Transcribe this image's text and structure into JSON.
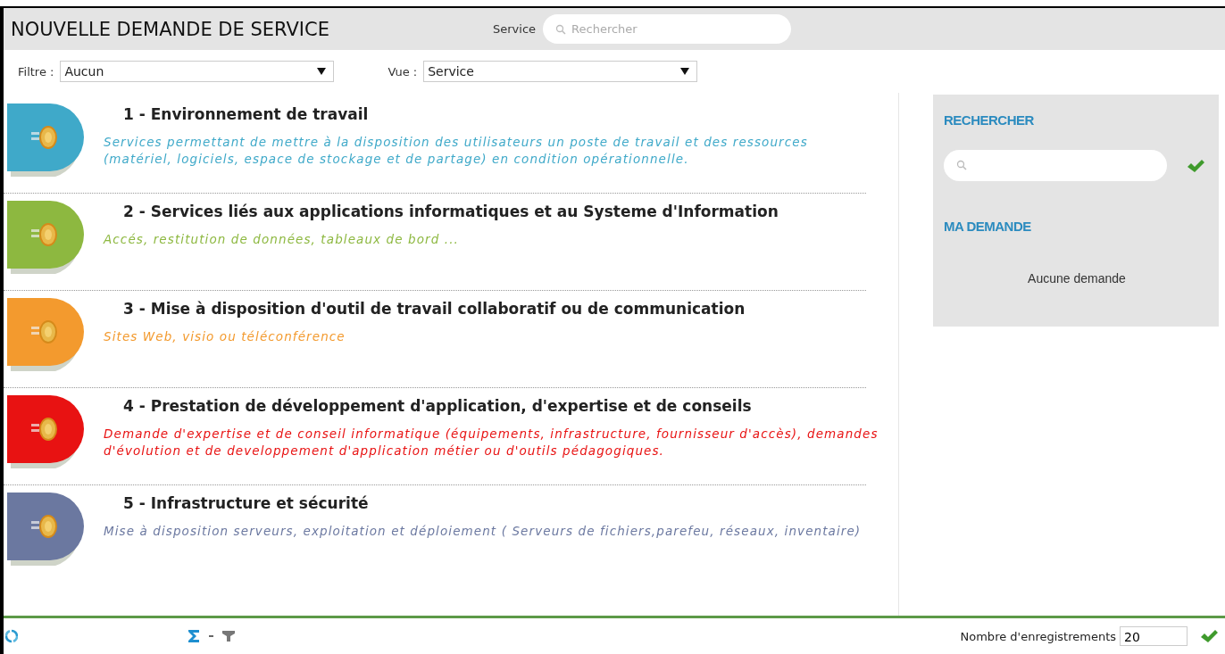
{
  "header": {
    "title": "NOUVELLE DEMANDE DE SERVICE",
    "search_label": "Service",
    "search": {
      "placeholder": "Rechercher"
    }
  },
  "filters": [
    {
      "label": "Filtre :",
      "value": "Aucun"
    },
    {
      "label": "Vue :",
      "value": "Service"
    }
  ],
  "services": [
    {
      "title": "1 - Environnement de travail",
      "description": "Services permettant de mettre à la disposition des utilisateurs un poste de travail et des ressources (matériel, logiciels, espace de stockage et de partage) en condition opérationnelle.",
      "color": "#3fa9c9"
    },
    {
      "title": "2 - Services liés aux applications informatiques et au Systeme d'Information",
      "description": "Accés, restitution de données, tableaux de bord ...",
      "color": "#8db840"
    },
    {
      "title": "3 - Mise à disposition d'outil de travail collaboratif ou de communication",
      "description": "Sites Web, visio ou téléconférence",
      "color": "#f39a2e"
    },
    {
      "title": "4 - Prestation de développement d'application, d'expertise et de conseils",
      "description": "Demande d'expertise et de conseil informatique (équipements, infrastructure, fournisseur d'accès), demandes d'évolution et de developpement d'application métier ou d'outils pédagogiques.",
      "color": "#e81212"
    },
    {
      "title": "5 - Infrastructure et sécurité",
      "description": "Mise à disposition serveurs, exploitation et déploiement ( Serveurs de fichiers,parefeu, réseaux, inventaire)",
      "color": "#6b78a0"
    }
  ],
  "sidebar": {
    "search_heading": "RECHERCHER",
    "request_heading": "MA DEMANDE",
    "request_status": "Aucune demande"
  },
  "footer": {
    "records_label": "Nombre d'enregistrements",
    "records_value": "20"
  }
}
